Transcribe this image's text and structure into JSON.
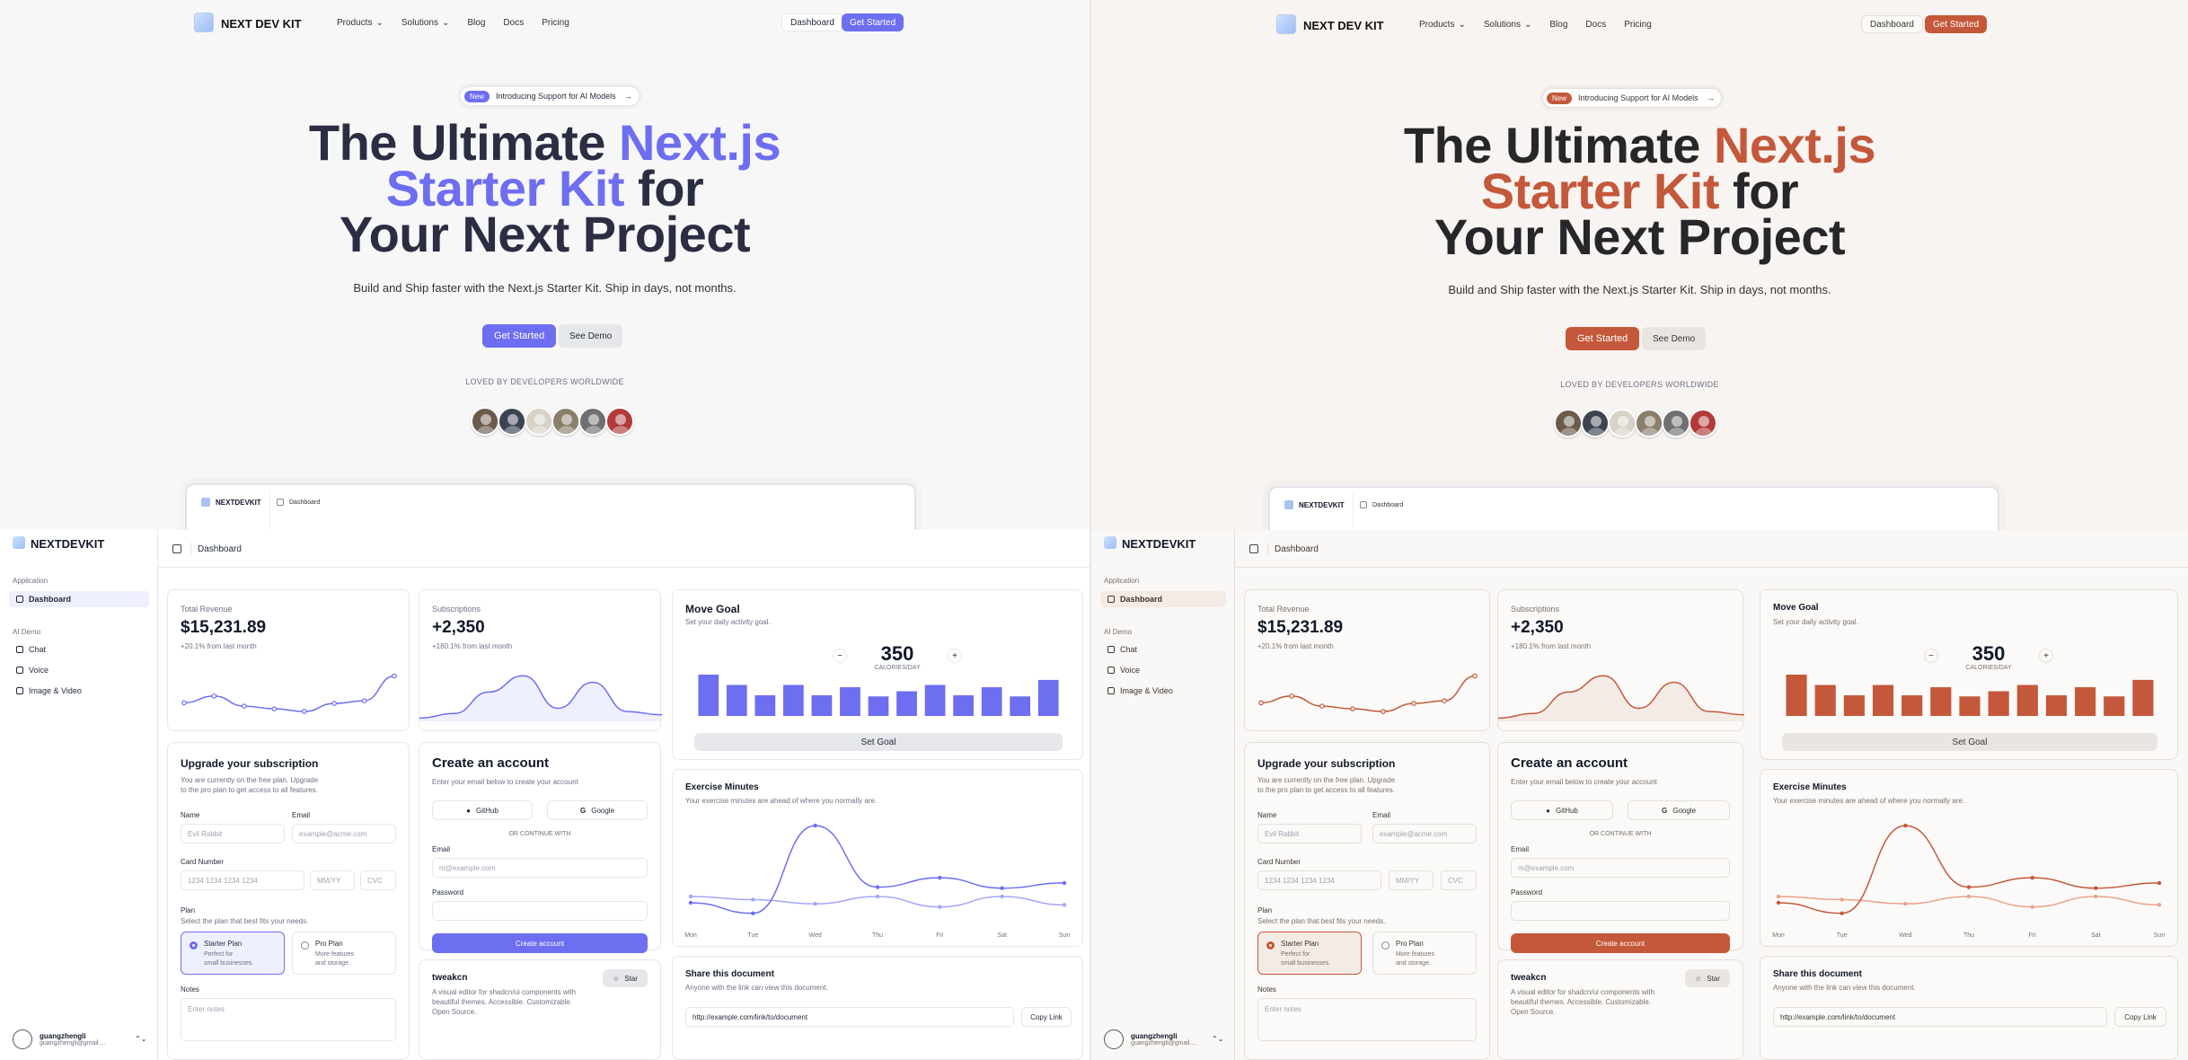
{
  "landing": {
    "brand": "NEXT DEV KIT",
    "nav_links": [
      {
        "label": "Products",
        "caret": true
      },
      {
        "label": "Solutions",
        "caret": true
      },
      {
        "label": "Blog",
        "caret": false
      },
      {
        "label": "Docs",
        "caret": false
      },
      {
        "label": "Pricing",
        "caret": false
      }
    ],
    "nav_dashboard": "Dashboard",
    "nav_get_started": "Get Started",
    "badge_new": "New",
    "badge_text": "Introducing Support for AI Models",
    "badge_arrow": "→",
    "hero_l1a": "The Ultimate ",
    "hero_l1b": "Next.js",
    "hero_l2a": "Starter Kit",
    "hero_l2b": " for",
    "hero_l3": "Your Next Project",
    "subtitle": "Build and Ship faster with the Next.js Starter Kit. Ship in days, not months.",
    "cta_primary": "Get Started",
    "cta_secondary": "See Demo",
    "loved_by": "LOVED BY DEVELOPERS WORLDWIDE",
    "avatars": [
      "avatar-1",
      "avatar-2",
      "avatar-3",
      "avatar-4",
      "avatar-5",
      "avatar-6"
    ],
    "preview_brand": "NEXTDEVKIT",
    "preview_crumb": "Dashboard"
  },
  "dashboard": {
    "brand": "NEXTDEVKIT",
    "group_application": "Application",
    "item_dashboard": "Dashboard",
    "group_ai": "AI Demo",
    "items_ai": [
      "Chat",
      "Voice",
      "Image & Video"
    ],
    "user_name": "guangzhengli",
    "user_email": "guangzhengli@gmail....",
    "user_chevron": "⌃⌄",
    "breadcrumb": "Dashboard",
    "revenue": {
      "title": "Total Revenue",
      "value": "$15,231.89",
      "sub": "+20.1% from last month",
      "points": [
        45,
        55,
        40,
        36,
        32,
        44,
        48,
        85
      ]
    },
    "subs": {
      "title": "Subscriptions",
      "value": "+2,350",
      "sub": "+180.1% from last month",
      "points": [
        5,
        12,
        45,
        70,
        20,
        60,
        15,
        10
      ]
    },
    "move_goal": {
      "title": "Move Goal",
      "sub": "Set your daily activity goal.",
      "value": "350",
      "unit": "CALORIES/DAY",
      "minus": "−",
      "plus": "+",
      "bars": [
        400,
        300,
        200,
        300,
        200,
        278,
        189,
        239,
        300,
        200,
        278,
        189,
        349
      ],
      "button": "Set Goal"
    },
    "upgrade": {
      "title": "Upgrade your subscription",
      "desc_l1": "You are currently on the free plan. Upgrade",
      "desc_l2": "to the pro plan to get access to all features.",
      "name_label": "Name",
      "name_placeholder": "Evil Rabbit",
      "email_label": "Email",
      "email_placeholder": "example@acme.com",
      "card_label": "Card Number",
      "card_placeholder": "1234 1234 1234 1234",
      "mm_placeholder": "MM/YY",
      "cvc_placeholder": "CVC",
      "plan_label": "Plan",
      "plan_desc": "Select the plan that best fits your needs.",
      "starter_title": "Starter Plan",
      "starter_l1": "Perfect for",
      "starter_l2": "small businesses.",
      "pro_title": "Pro Plan",
      "pro_l1": "More features",
      "pro_l2": "and storage.",
      "notes_label": "Notes",
      "notes_placeholder": "Enter notes"
    },
    "account": {
      "title": "Create an account",
      "desc": "Enter your email below to create your account",
      "github": "GitHub",
      "google": "Google",
      "divider": "OR CONTINUE WITH",
      "email_label": "Email",
      "email_placeholder": "m@example.com",
      "password_label": "Password",
      "button": "Create account"
    },
    "tweakcn": {
      "title": "tweakcn",
      "star": "Star",
      "desc_l1": "A visual editor for shadcn/ui components with",
      "desc_l2": "beautiful themes. Accessible. Customizable.",
      "desc_l3": "Open Source."
    },
    "exercise": {
      "title": "Exercise Minutes",
      "sub": "Your exercise minutes are ahead of where you normally are.",
      "days": [
        "Mon",
        "Tue",
        "Wed",
        "Thu",
        "Fri",
        "Sat",
        "Sun"
      ]
    },
    "share": {
      "title": "Share this document",
      "sub": "Anyone with the link can view this document.",
      "link": "http://example.com/link/to/document",
      "button": "Copy Link"
    }
  },
  "chart_data": [
    {
      "type": "line",
      "series": [
        {
          "values": [
            45,
            55,
            40,
            36,
            32,
            44,
            48,
            85
          ]
        }
      ]
    },
    {
      "type": "area",
      "series": [
        {
          "values": [
            5,
            12,
            45,
            70,
            20,
            60,
            15,
            10
          ]
        }
      ]
    },
    {
      "type": "bar",
      "values": [
        400,
        300,
        200,
        300,
        200,
        278,
        189,
        239,
        300,
        200,
        278,
        189,
        349
      ]
    },
    {
      "type": "line",
      "categories": [
        "Mon",
        "Tue",
        "Wed",
        "Thu",
        "Fri",
        "Sat",
        "Sun"
      ],
      "series": [
        {
          "values": [
            240,
            139,
            980,
            390,
            480,
            380,
            430
          ]
        },
        {
          "values": [
            300,
            270,
            230,
            300,
            200,
            300,
            220
          ]
        }
      ]
    }
  ],
  "colors": {
    "blue_accent": "#6d6ef0",
    "orange_accent": "#c4583a"
  }
}
